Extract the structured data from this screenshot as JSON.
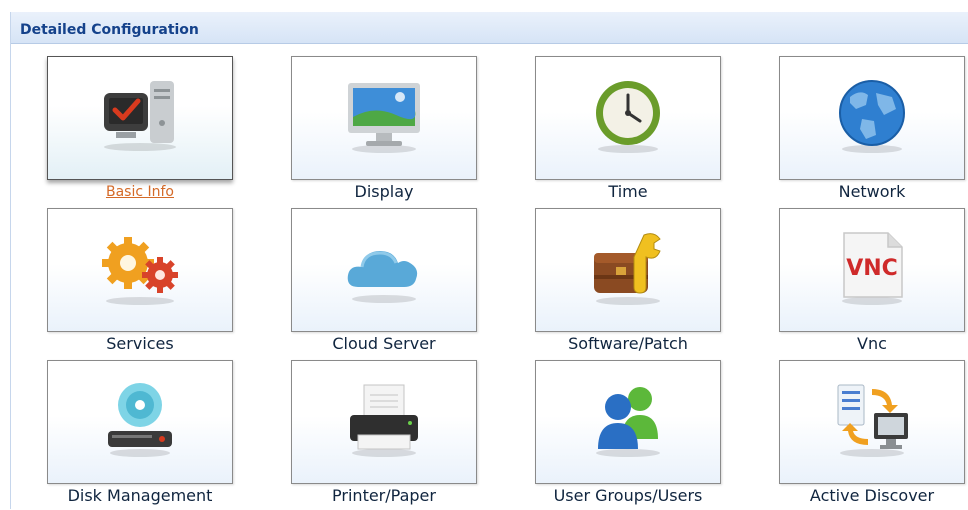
{
  "panel": {
    "title": "Detailed Configuration"
  },
  "tiles": [
    {
      "label": "Basic Info",
      "icon": "computer-check-icon",
      "selected": true
    },
    {
      "label": "Display",
      "icon": "monitor-icon"
    },
    {
      "label": "Time",
      "icon": "clock-icon"
    },
    {
      "label": "Network",
      "icon": "globe-icon"
    },
    {
      "label": "Services",
      "icon": "gears-icon"
    },
    {
      "label": "Cloud Server",
      "icon": "cloud-icon"
    },
    {
      "label": "Software/Patch",
      "icon": "toolbox-wrench-icon"
    },
    {
      "label": "Vnc",
      "icon": "vnc-document-icon",
      "icon_text": "VNC"
    },
    {
      "label": "Disk Management",
      "icon": "disk-drive-icon"
    },
    {
      "label": "Printer/Paper",
      "icon": "printer-icon"
    },
    {
      "label": "User Groups/Users",
      "icon": "users-icon"
    },
    {
      "label": "Active Discover",
      "icon": "server-sync-icon"
    }
  ],
  "colors": {
    "header_text": "#15428b",
    "selected_label": "#d46a28",
    "label_text": "#10253f"
  }
}
